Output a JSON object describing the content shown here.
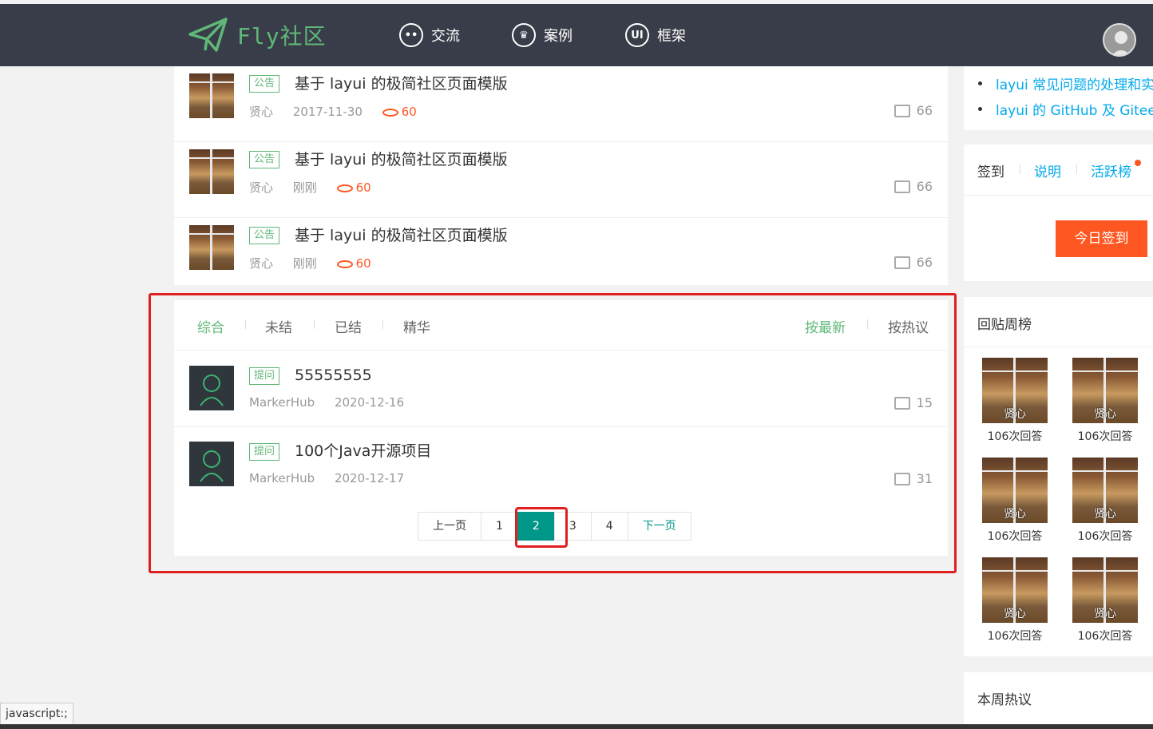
{
  "header": {
    "logo_text": "Fly社区",
    "nav": [
      {
        "label": "交流",
        "icon": "chat-icon"
      },
      {
        "label": "案例",
        "icon": "crown-icon"
      },
      {
        "label": "框架",
        "icon": "ui-icon"
      }
    ]
  },
  "top_posts": [
    {
      "badge": "公告",
      "title": "基于 layui 的极简社区页面模版",
      "author": "贤心",
      "date": "2017-11-30",
      "hot": "60",
      "comments": "66"
    },
    {
      "badge": "公告",
      "title": "基于 layui 的极简社区页面模版",
      "author": "贤心",
      "date": "刚刚",
      "hot": "60",
      "comments": "66"
    },
    {
      "badge": "公告",
      "title": "基于 layui 的极简社区页面模版",
      "author": "贤心",
      "date": "刚刚",
      "hot": "60",
      "comments": "66"
    }
  ],
  "filter_tabs": [
    "综合",
    "未结",
    "已结",
    "精华"
  ],
  "sort_tabs": [
    "按最新",
    "按热议"
  ],
  "list_posts": [
    {
      "badge": "提问",
      "title": "55555555",
      "author": "MarkerHub",
      "date": "2020-12-16",
      "comments": "15"
    },
    {
      "badge": "提问",
      "title": "100个Java开源项目",
      "author": "MarkerHub",
      "date": "2020-12-17",
      "comments": "31"
    }
  ],
  "pager": {
    "prev": "上一页",
    "pages": [
      "1",
      "2",
      "3",
      "4"
    ],
    "current": "2",
    "next": "下一页"
  },
  "side_links": [
    "layui 常见问题的处理和实",
    "layui 的 GitHub 及 Gitee ("
  ],
  "signin": {
    "tabs": [
      "签到",
      "说明",
      "活跃榜"
    ],
    "button": "今日签到"
  },
  "weekly": {
    "title": "回贴周榜",
    "users": [
      {
        "name": "贤心",
        "count": "106次回答"
      },
      {
        "name": "贤心",
        "count": "106次回答"
      },
      {
        "name": "贤心",
        "count": "106次回答"
      },
      {
        "name": "贤心",
        "count": "106次回答"
      },
      {
        "name": "贤心",
        "count": "106次回答"
      },
      {
        "name": "贤心",
        "count": "106次回答"
      }
    ]
  },
  "hot_week_title": "本周热议",
  "status_text": "javascript:;",
  "colors": {
    "header_bg": "#393d49",
    "accent": "#5FB878",
    "pager_active": "#009688",
    "hot": "#FF5722",
    "link": "#01AAED",
    "highlight": "#e02020"
  }
}
